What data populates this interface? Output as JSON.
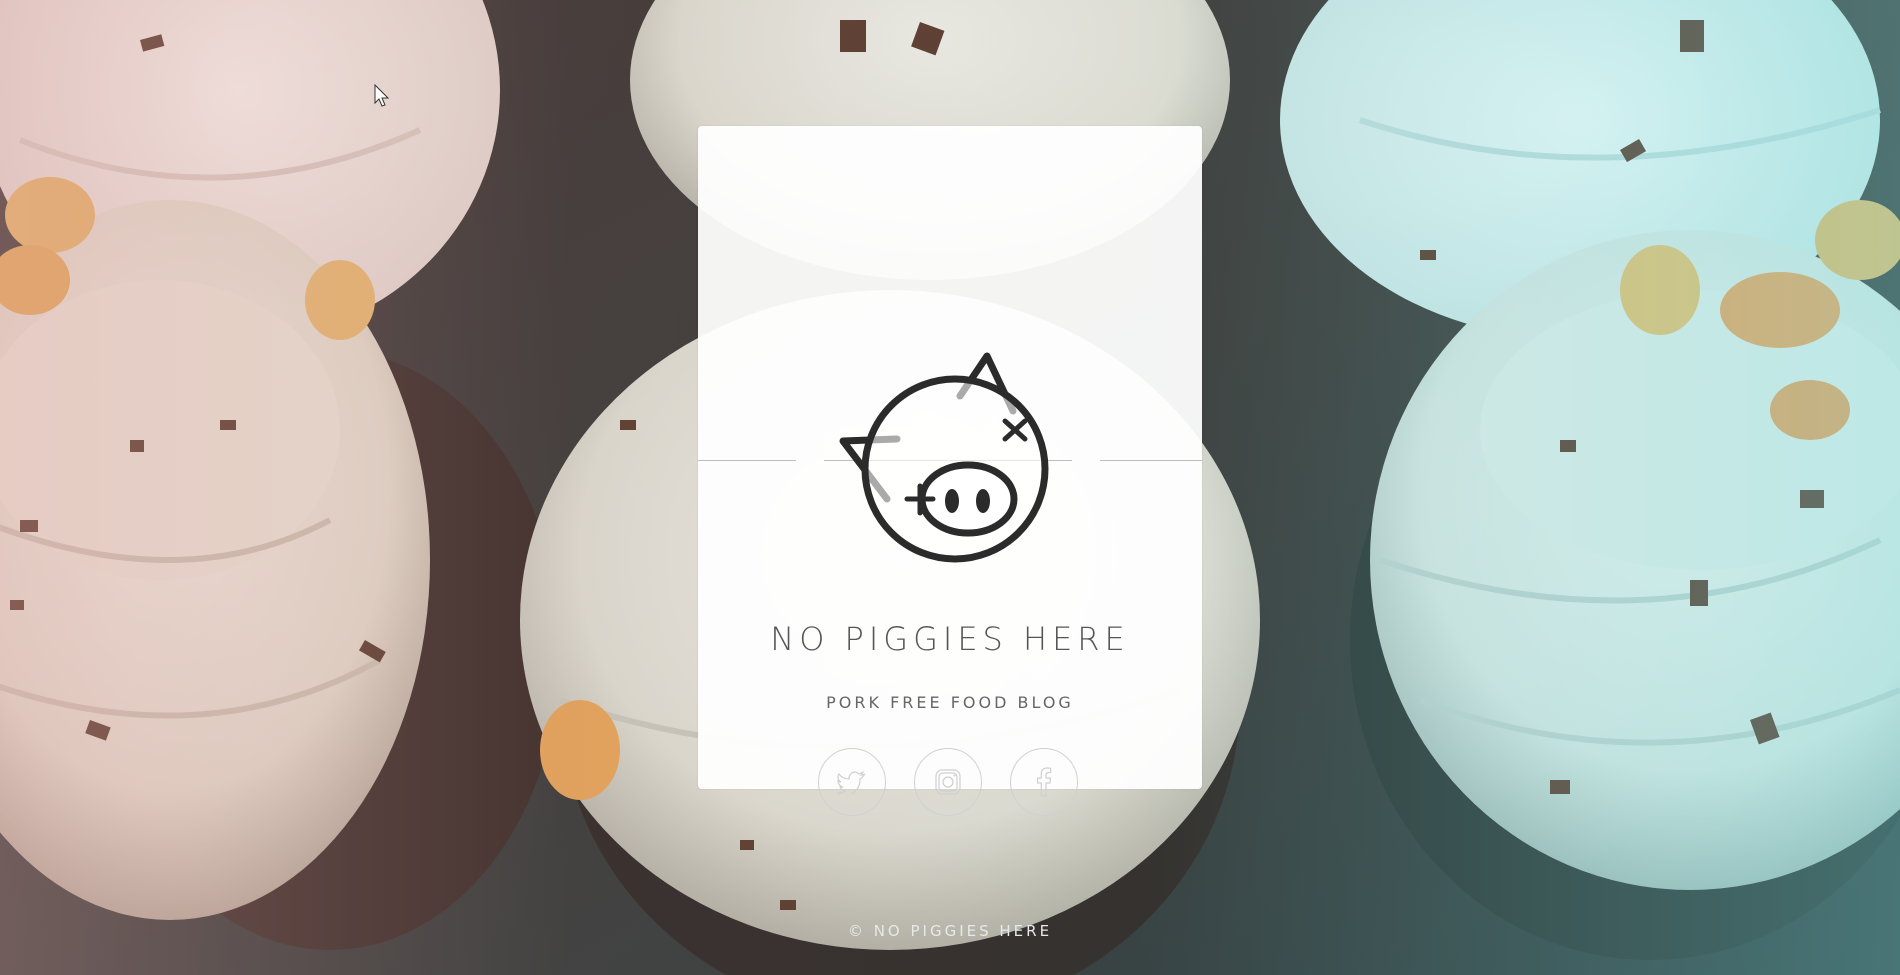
{
  "site": {
    "title": "NO PIGGIES HERE",
    "tagline": "PORK FREE FOOD BLOG"
  },
  "logo": {
    "icon": "pig-face-icon"
  },
  "social": [
    {
      "name": "Twitter",
      "icon": "twitter-icon"
    },
    {
      "name": "Instagram",
      "icon": "instagram-icon"
    },
    {
      "name": "Facebook",
      "icon": "facebook-icon"
    }
  ],
  "footer": {
    "copyright": "© NO PIGGIES HERE"
  },
  "colors": {
    "card": "#ffffff",
    "title_text": "#555555",
    "footer_text": "#e8e8e8",
    "icon_stroke": "#cfcfcf",
    "logo_stroke": "#2b2b2b"
  }
}
